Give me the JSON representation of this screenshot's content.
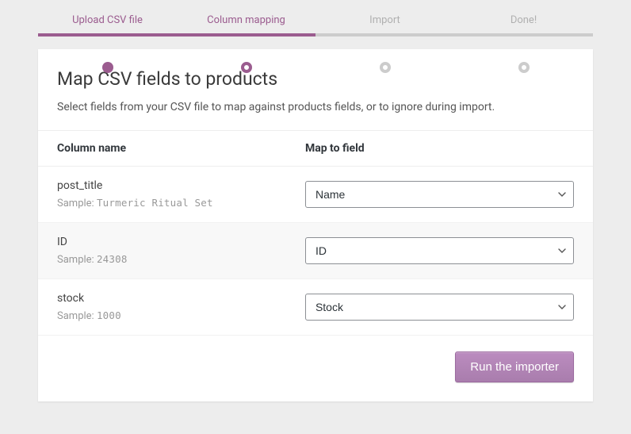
{
  "stepper": {
    "steps": [
      {
        "label": "Upload CSV file",
        "state": "completed"
      },
      {
        "label": "Column mapping",
        "state": "active"
      },
      {
        "label": "Import",
        "state": "pending"
      },
      {
        "label": "Done!",
        "state": "pending"
      }
    ]
  },
  "header": {
    "title": "Map CSV fields to products",
    "description": "Select fields from your CSV file to map against products fields, or to ignore during import."
  },
  "table": {
    "col_name_header": "Column name",
    "map_to_header": "Map to field",
    "sample_prefix": "Sample:",
    "rows": [
      {
        "name": "post_title",
        "sample": "Turmeric Ritual Set",
        "selected": "Name"
      },
      {
        "name": "ID",
        "sample": "24308",
        "selected": "ID"
      },
      {
        "name": "stock",
        "sample": "1000",
        "selected": "Stock"
      }
    ]
  },
  "actions": {
    "run_label": "Run the importer"
  },
  "colors": {
    "accent": "#9b5c8f"
  }
}
